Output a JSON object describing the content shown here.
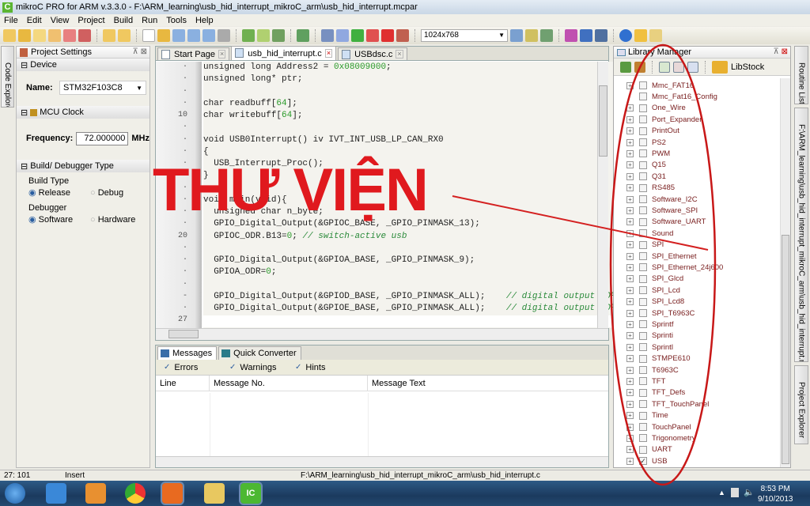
{
  "window": {
    "title": "mikroC PRO for ARM v.3.3.0 - F:\\ARM_learning\\usb_hid_interrupt_mikroC_arm\\usb_hid_interrupt.mcpar",
    "app_icon": "C"
  },
  "menu": [
    "File",
    "Edit",
    "View",
    "Project",
    "Build",
    "Run",
    "Tools",
    "Help"
  ],
  "toolbar": {
    "resolution": "1024x768"
  },
  "left_tabs": {
    "code_explorer": "Code Explorer"
  },
  "project_settings": {
    "title": "Project Settings",
    "device_section": "Device",
    "name_label": "Name:",
    "device_name": "STM32F103C8",
    "clock_section": "MCU Clock",
    "freq_label": "Frequency:",
    "freq_value": "72.000000",
    "freq_unit": "MHz",
    "build_section": "Build/ Debugger Type",
    "build_type_label": "Build Type",
    "release": "Release",
    "debug": "Debug",
    "debugger_label": "Debugger",
    "software": "Software",
    "hardware": "Hardware"
  },
  "editor": {
    "tabs": [
      {
        "label": "Start Page"
      },
      {
        "label": "usb_hid_interrupt.c"
      },
      {
        "label": "USBdsc.c"
      }
    ],
    "lines": [
      {
        "g": "·",
        "t": "unsigned long Address2 = ",
        "n": "0x08009000",
        "r": ";"
      },
      {
        "g": "·",
        "t": "unsigned long* ptr;"
      },
      {
        "g": "·",
        "t": ""
      },
      {
        "g": "·",
        "t": "char readbuff[",
        "n": "64",
        "r": "];"
      },
      {
        "g": "10",
        "t": "char writebuff[",
        "n": "64",
        "r": "];"
      },
      {
        "g": "·",
        "t": ""
      },
      {
        "g": "·",
        "t": "void USB0Interrupt() iv IVT_INT_USB_LP_CAN_RX0"
      },
      {
        "g": "·",
        "t": "{"
      },
      {
        "g": "·",
        "t": "  USB_Interrupt_Proc();"
      },
      {
        "g": "-",
        "t": "}"
      },
      {
        "g": "·",
        "t": ""
      },
      {
        "g": "·",
        "t": "void main(void){"
      },
      {
        "g": "·",
        "t": "  unsigned char n_byte;"
      },
      {
        "g": "·",
        "t": "  GPIO_Digital_Output(&GPIOC_BASE, _GPIO_PINMASK_13);"
      },
      {
        "g": "20",
        "t": "  GPIOC_ODR.B13=",
        "n": "0",
        "r": "; ",
        "c": "// switch-active usb"
      },
      {
        "g": "·",
        "t": ""
      },
      {
        "g": "·",
        "t": "  GPIO_Digital_Output(&GPIOA_BASE, _GPIO_PINMASK_9);"
      },
      {
        "g": "·",
        "t": "  GPIOA_ODR=",
        "n": "0",
        "r": ";"
      },
      {
        "g": "·",
        "t": ""
      },
      {
        "g": "-",
        "t": "  GPIO_Digital_Output(&GPIOD_BASE, _GPIO_PINMASK_ALL);    ",
        "c": "// digital output POR"
      },
      {
        "g": "·",
        "t": "  GPIO_Digital_Output(&GPIOE_BASE, _GPIO_PINMASK_ALL);    ",
        "c": "// digital output POR"
      },
      {
        "g": "27",
        "t": "",
        "cur": true
      }
    ]
  },
  "messages": {
    "tabs": [
      "Messages",
      "Quick Converter"
    ],
    "filters": [
      "Errors",
      "Warnings",
      "Hints"
    ],
    "columns": [
      "Line",
      "Message No.",
      "Message Text"
    ]
  },
  "library_manager": {
    "title": "Library Manager",
    "libstock": "LibStock",
    "items": [
      {
        "n": "Mmc_FAT16"
      },
      {
        "n": "Mmc_Fat16_Config",
        "leaf": true
      },
      {
        "n": "One_Wire"
      },
      {
        "n": "Port_Expander"
      },
      {
        "n": "PrintOut"
      },
      {
        "n": "PS2"
      },
      {
        "n": "PWM"
      },
      {
        "n": "Q15"
      },
      {
        "n": "Q31"
      },
      {
        "n": "RS485"
      },
      {
        "n": "Software_I2C"
      },
      {
        "n": "Software_SPI"
      },
      {
        "n": "Software_UART"
      },
      {
        "n": "Sound"
      },
      {
        "n": "SPI"
      },
      {
        "n": "SPI_Ethernet"
      },
      {
        "n": "SPI_Ethernet_24j600"
      },
      {
        "n": "SPI_Glcd"
      },
      {
        "n": "SPI_Lcd"
      },
      {
        "n": "SPI_Lcd8"
      },
      {
        "n": "SPI_T6963C"
      },
      {
        "n": "Sprintf"
      },
      {
        "n": "Sprinti"
      },
      {
        "n": "Sprintl"
      },
      {
        "n": "STMPE610"
      },
      {
        "n": "T6963C"
      },
      {
        "n": "TFT"
      },
      {
        "n": "TFT_Defs"
      },
      {
        "n": "TFT_TouchPanel"
      },
      {
        "n": "Time"
      },
      {
        "n": "TouchPanel"
      },
      {
        "n": "Trigonometry"
      },
      {
        "n": "UART"
      },
      {
        "n": "USB",
        "checked": true
      }
    ]
  },
  "right_tabs": {
    "routine_list": "Routine List",
    "project_file": "F:\\ARM_learning\\usb_hid_interrupt_mikroC_arm\\usb_hid_interrupt.mcpar",
    "project_explorer": "Project Explorer"
  },
  "status": {
    "position": "27: 101",
    "mode": "Insert",
    "file": "F:\\ARM_learning\\usb_hid_interrupt_mikroC_arm\\usb_hid_interrupt.c"
  },
  "taskbar": {
    "time": "8:53 PM",
    "date": "9/10/2013"
  },
  "annotation": {
    "text": "THƯ VIỆN",
    "color": "#e0191e"
  }
}
